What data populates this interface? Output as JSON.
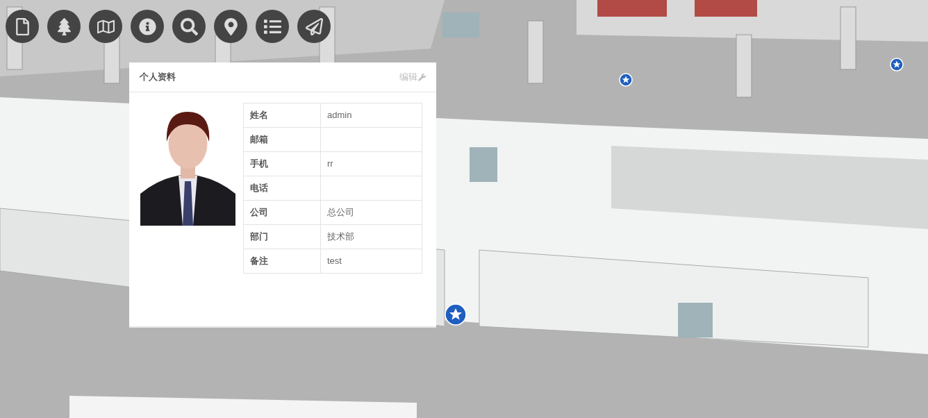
{
  "toolbar": [
    {
      "kind": "file"
    },
    {
      "kind": "tree"
    },
    {
      "kind": "map"
    },
    {
      "kind": "info"
    },
    {
      "kind": "search"
    },
    {
      "kind": "marker"
    },
    {
      "kind": "list"
    },
    {
      "kind": "send"
    }
  ],
  "profile_panel": {
    "title": "个人资料",
    "edit_link": "编辑",
    "fields": [
      {
        "label": "姓名",
        "value": "admin"
      },
      {
        "label": "邮箱"
      },
      {
        "label": "手机",
        "value": "rr"
      },
      {
        "label": "电话"
      },
      {
        "label": "公司",
        "value": "总公司"
      },
      {
        "label": "部门",
        "value": "技术部"
      },
      {
        "label": "备注",
        "value": "test"
      }
    ]
  }
}
